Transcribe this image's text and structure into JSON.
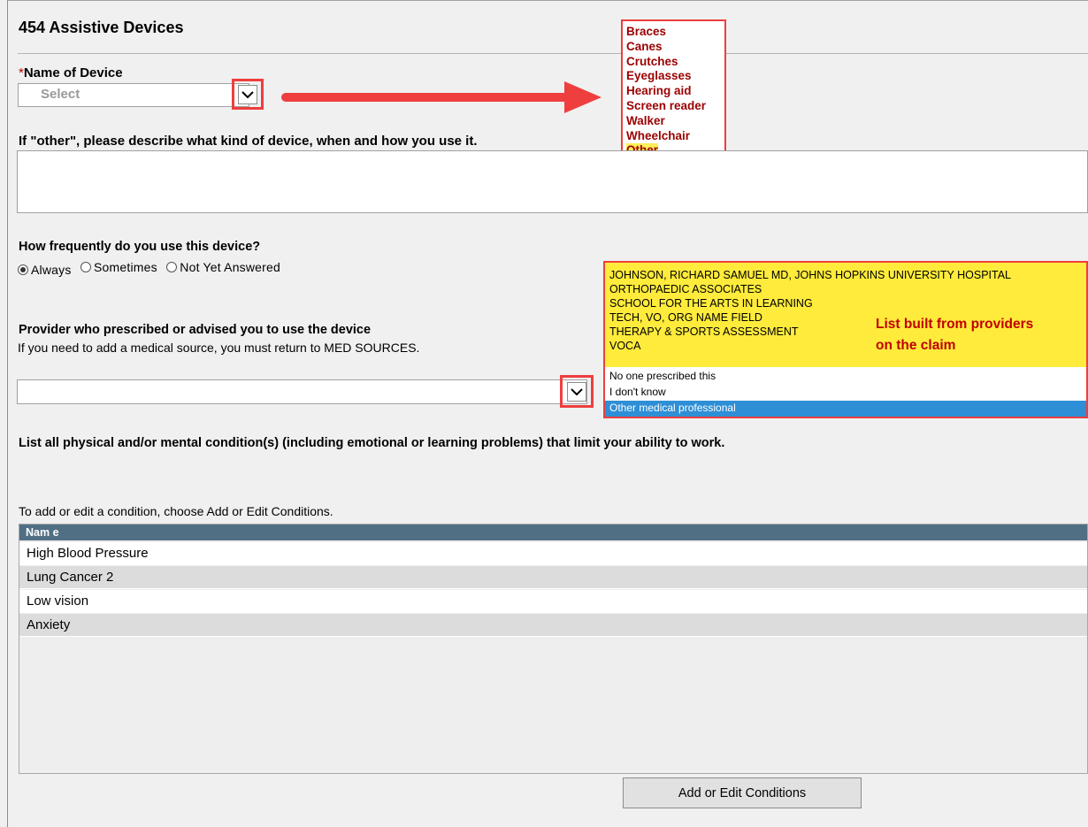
{
  "page": {
    "title": "454 Assistive Devices"
  },
  "device": {
    "required_mark": "*",
    "label": "Name of Device",
    "placeholder": "Select",
    "options": [
      "Braces",
      "Canes",
      "Crutches",
      "Eyeglasses",
      "Hearing aid",
      "Screen reader",
      "Walker",
      "Wheelchair",
      "Other"
    ],
    "highlighted_option": "Other"
  },
  "other_desc": {
    "label": "If \"other\", please describe what kind of device, when and how you use it.",
    "value": ""
  },
  "frequency": {
    "label": "How frequently do you use this device?",
    "options": [
      "Always",
      "Sometimes",
      "Not Yet Answered"
    ],
    "selected": "Always"
  },
  "provider": {
    "label": "Provider who prescribed or advised you to use the device",
    "help": "If you need to add a medical source, you must return to MED SOURCES.",
    "value": "",
    "claim_options": [
      "JOHNSON, RICHARD SAMUEL MD, JOHNS HOPKINS UNIVERSITY HOSPITAL",
      "ORTHOPAEDIC ASSOCIATES",
      "SCHOOL FOR THE ARTS IN LEARNING",
      "TECH, VO, ORG NAME FIELD",
      "THERAPY & SPORTS ASSESSMENT",
      "VOCA"
    ],
    "other_options": [
      "No one prescribed this",
      "I don't know",
      "Other medical professional"
    ],
    "selected_option": "Other medical professional",
    "callout_line1": "List built from providers",
    "callout_line2": "on the claim"
  },
  "conditions": {
    "heading": "List all physical and/or mental condition(s) (including emotional or learning problems) that limit your ability to work.",
    "help": "To add or edit a condition, choose Add or Edit Conditions.",
    "column_header": "Nam e",
    "rows": [
      "High Blood Pressure",
      "Lung Cancer 2",
      "Low vision",
      "Anxiety"
    ],
    "button_label": "Add or Edit Conditions"
  },
  "colors": {
    "annotation_red": "#ef3e3e",
    "highlight_yellow": "#ffeb3b",
    "selection_blue": "#2e8fd6",
    "grid_header": "#516f84"
  }
}
